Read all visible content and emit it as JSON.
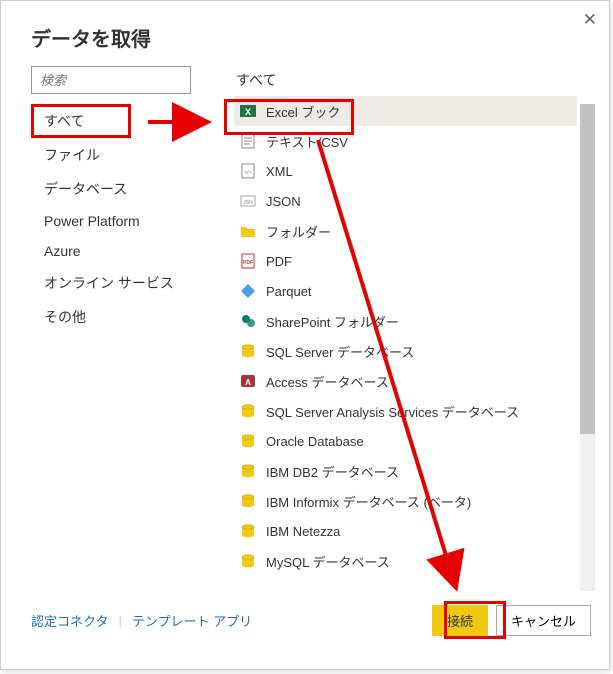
{
  "dialog": {
    "title": "データを取得"
  },
  "search": {
    "placeholder": "検索"
  },
  "categories": [
    {
      "label": "すべて",
      "selected": true
    },
    {
      "label": "ファイル"
    },
    {
      "label": "データベース"
    },
    {
      "label": "Power Platform"
    },
    {
      "label": "Azure"
    },
    {
      "label": "オンライン サービス"
    },
    {
      "label": "その他"
    }
  ],
  "list_title": "すべて",
  "connectors": [
    {
      "label": "Excel ブック",
      "icon": "excel",
      "selected": true
    },
    {
      "label": "テキスト/CSV",
      "icon": "text"
    },
    {
      "label": "XML",
      "icon": "xml"
    },
    {
      "label": "JSON",
      "icon": "json"
    },
    {
      "label": "フォルダー",
      "icon": "folder"
    },
    {
      "label": "PDF",
      "icon": "pdf"
    },
    {
      "label": "Parquet",
      "icon": "parquet"
    },
    {
      "label": "SharePoint フォルダー",
      "icon": "sharepoint"
    },
    {
      "label": "SQL Server データベース",
      "icon": "db"
    },
    {
      "label": "Access データベース",
      "icon": "access"
    },
    {
      "label": "SQL Server Analysis Services データベース",
      "icon": "db"
    },
    {
      "label": "Oracle Database",
      "icon": "db"
    },
    {
      "label": "IBM DB2 データベース",
      "icon": "db"
    },
    {
      "label": "IBM Informix データベース (ベータ)",
      "icon": "db"
    },
    {
      "label": "IBM Netezza",
      "icon": "db"
    },
    {
      "label": "MySQL データベース",
      "icon": "db"
    }
  ],
  "footer": {
    "cert_link": "認定コネクタ",
    "template_link": "テンプレート アプリ",
    "connect": "接続",
    "cancel": "キャンセル"
  },
  "annotations": {
    "box_all_category": true,
    "box_excel_item": true,
    "box_connect_button": true,
    "arrow_category_to_excel": true,
    "arrow_excel_to_connect": true
  },
  "close_glyph": "✕"
}
